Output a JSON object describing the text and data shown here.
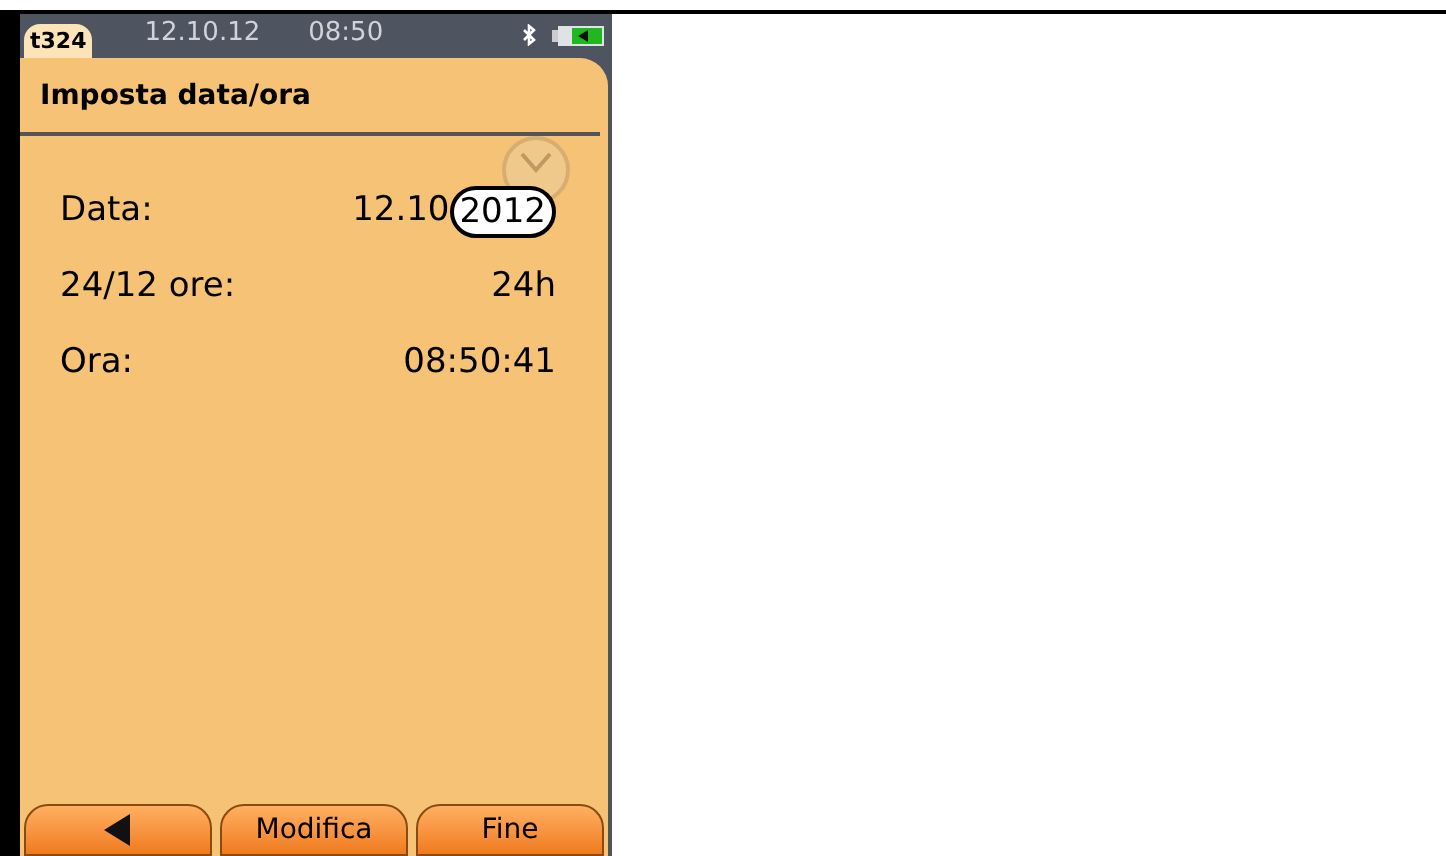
{
  "status_bar": {
    "tab": "t324",
    "date": "12.10.12",
    "time": "08:50"
  },
  "title": "Imposta data/ora",
  "rows": [
    {
      "label": "Data:",
      "parts": [
        {
          "text": "12.10",
          "selected": false
        },
        {
          "text": "2012",
          "selected": true
        }
      ]
    },
    {
      "label": "24/12 ore:",
      "parts": [
        {
          "text": "24h",
          "selected": false
        }
      ]
    },
    {
      "label": "Ora:",
      "parts": [
        {
          "text": "08:50:41",
          "selected": false
        }
      ]
    }
  ],
  "buttons": [
    {
      "kind": "back"
    },
    {
      "kind": "text",
      "label": "Modifica"
    },
    {
      "kind": "text",
      "label": "Fine"
    }
  ]
}
